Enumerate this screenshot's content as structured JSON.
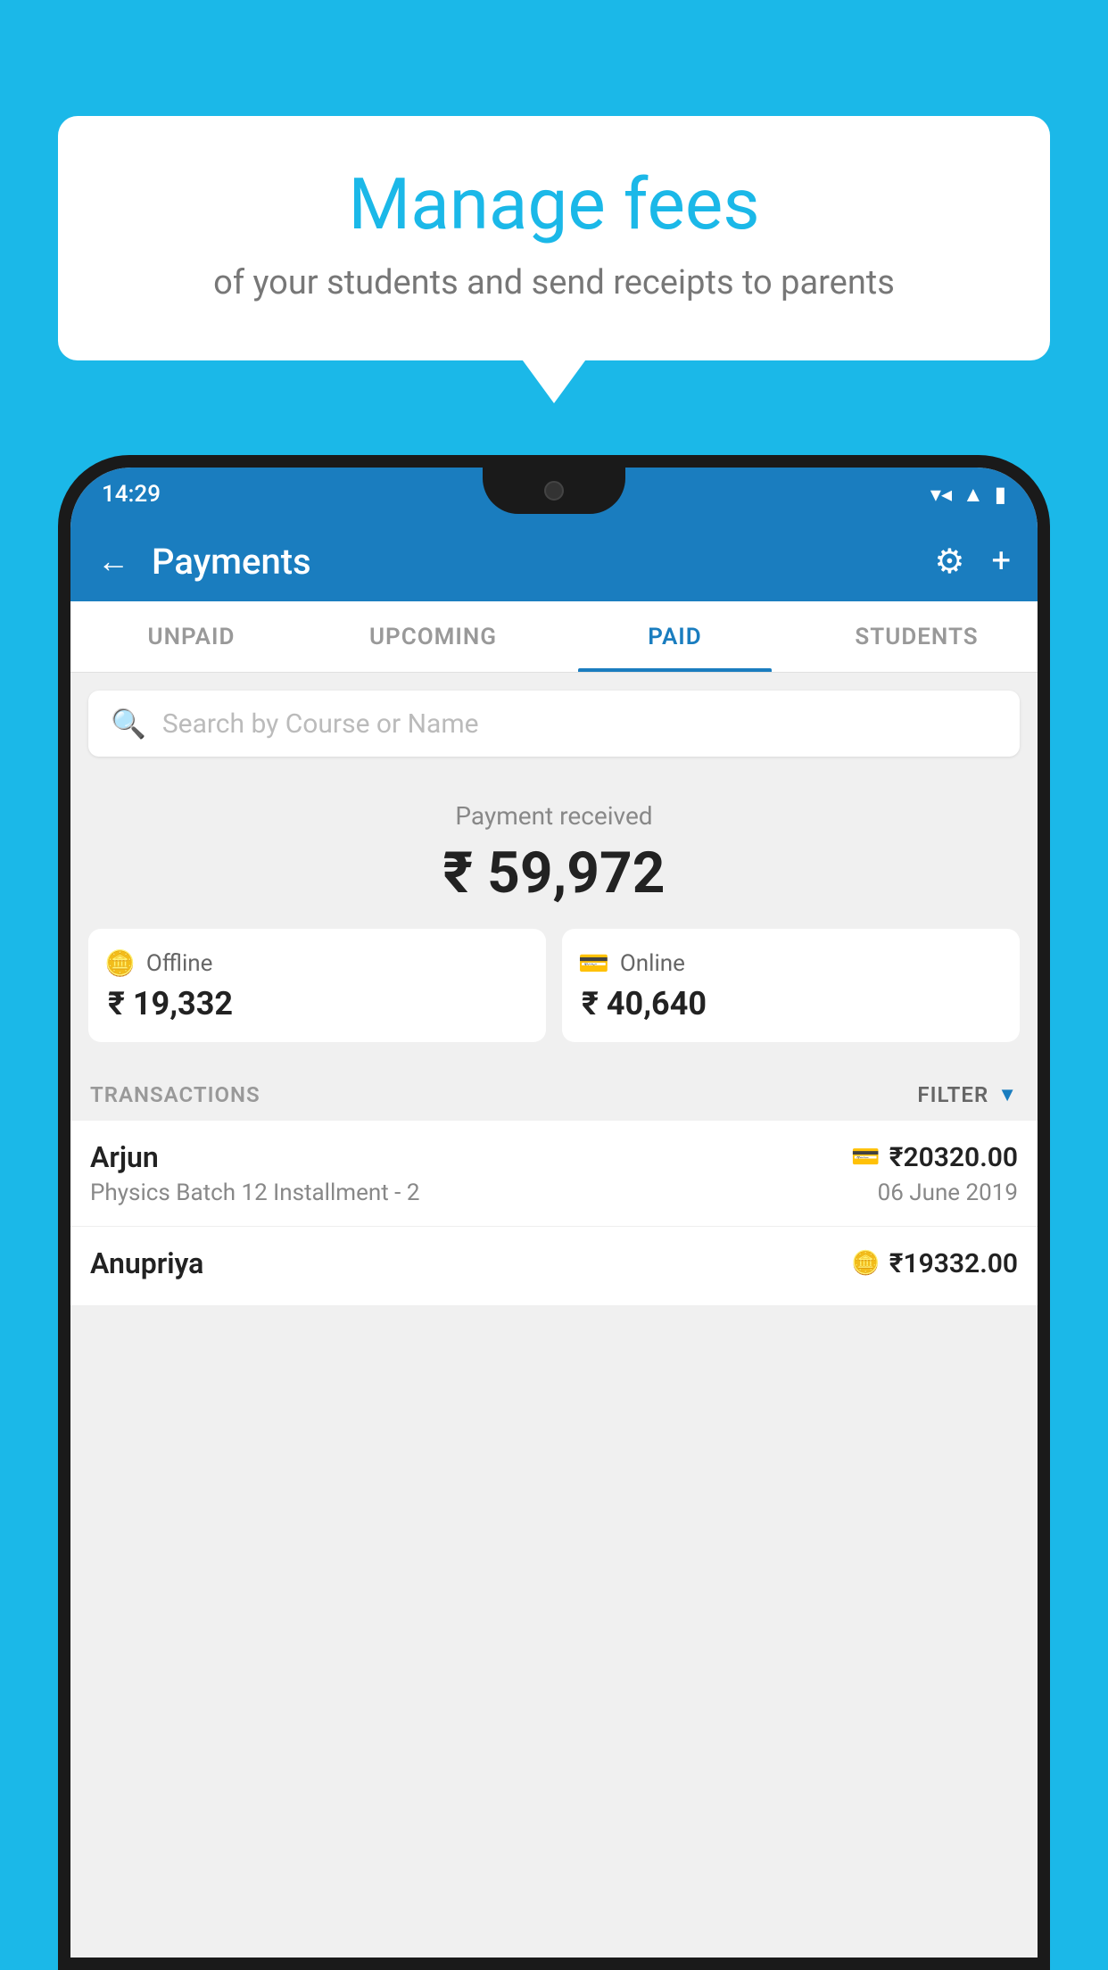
{
  "bubble": {
    "title": "Manage fees",
    "subtitle": "of your students and send receipts to parents"
  },
  "statusBar": {
    "time": "14:29",
    "icons": [
      "wifi",
      "signal",
      "battery"
    ]
  },
  "appBar": {
    "title": "Payments",
    "backLabel": "←",
    "gearLabel": "⚙",
    "plusLabel": "+"
  },
  "tabs": [
    {
      "label": "UNPAID",
      "active": false
    },
    {
      "label": "UPCOMING",
      "active": false
    },
    {
      "label": "PAID",
      "active": true
    },
    {
      "label": "STUDENTS",
      "active": false
    }
  ],
  "search": {
    "placeholder": "Search by Course or Name"
  },
  "payment": {
    "receivedLabel": "Payment received",
    "totalAmount": "₹ 59,972",
    "offlineLabel": "Offline",
    "offlineAmount": "₹ 19,332",
    "onlineLabel": "Online",
    "onlineAmount": "₹ 40,640"
  },
  "transactions": {
    "headerLabel": "TRANSACTIONS",
    "filterLabel": "FILTER",
    "rows": [
      {
        "name": "Arjun",
        "course": "Physics Batch 12 Installment - 2",
        "amount": "₹20320.00",
        "date": "06 June 2019",
        "paymentType": "card"
      },
      {
        "name": "Anupriya",
        "course": "",
        "amount": "₹19332.00",
        "date": "",
        "paymentType": "cash"
      }
    ]
  },
  "colors": {
    "primary": "#1a7dbf",
    "background": "#1BB8E8",
    "white": "#ffffff"
  }
}
